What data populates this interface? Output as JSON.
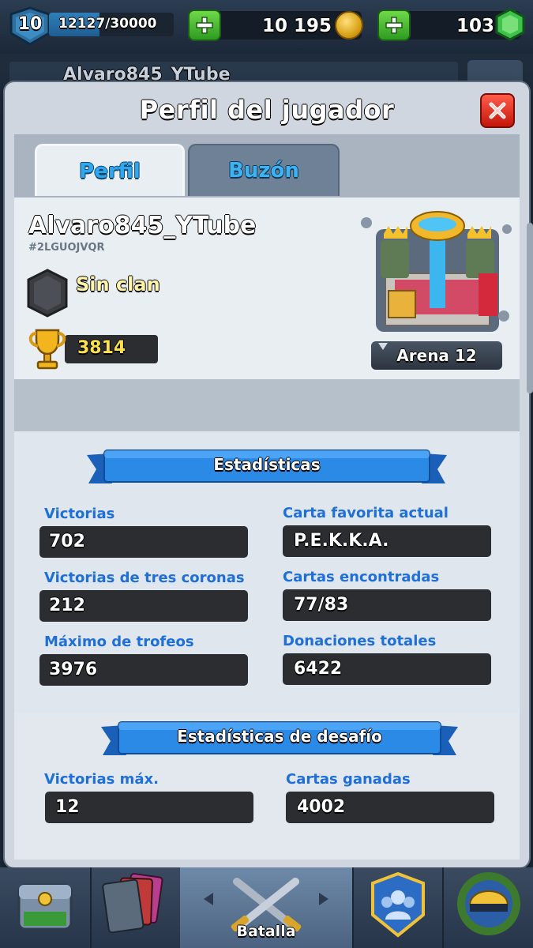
{
  "hud": {
    "level": "10",
    "xp_text": "12127/30000",
    "xp_fraction": 0.404,
    "gold": "10 195",
    "gems": "103"
  },
  "background": {
    "player_name_behind": "Alvaro845_YTube"
  },
  "modal": {
    "title": "Perfil del jugador",
    "tabs": [
      {
        "label": "Perfil",
        "active": true
      },
      {
        "label": "Buzón",
        "active": false
      }
    ],
    "player": {
      "name": "Alvaro845_YTube",
      "tag": "#2LGUOJVQR",
      "clan": "Sin clan",
      "trophies": "3814",
      "arena": "Arena 12"
    },
    "stats": {
      "section_title": "Estadísticas",
      "items": [
        {
          "label": "Victorias",
          "value": "702"
        },
        {
          "label": "Carta favorita actual",
          "value": "P.E.K.K.A."
        },
        {
          "label": "Victorias de tres coronas",
          "value": "212"
        },
        {
          "label": "Cartas encontradas",
          "value": "77/83"
        },
        {
          "label": "Máximo de trofeos",
          "value": "3976"
        },
        {
          "label": "Donaciones totales",
          "value": "6422"
        }
      ]
    },
    "challenge": {
      "section_title": "Estadísticas de desafío",
      "items": [
        {
          "label": "Victorias máx.",
          "value": "12"
        },
        {
          "label": "Cartas ganadas",
          "value": "4002"
        }
      ]
    }
  },
  "bottom_nav": {
    "battle_label": "Batalla",
    "items": [
      "shop-icon",
      "cards-icon",
      "battle-icon",
      "social-icon",
      "tournament-icon"
    ]
  },
  "colors": {
    "accent_blue": "#1f6fd8",
    "ribbon_blue": "#2a8ae6",
    "stat_box": "#2b2d30",
    "trophy_gold": "#ffe24a",
    "close_red": "#d8261a",
    "plus_green": "#3bb52c"
  }
}
